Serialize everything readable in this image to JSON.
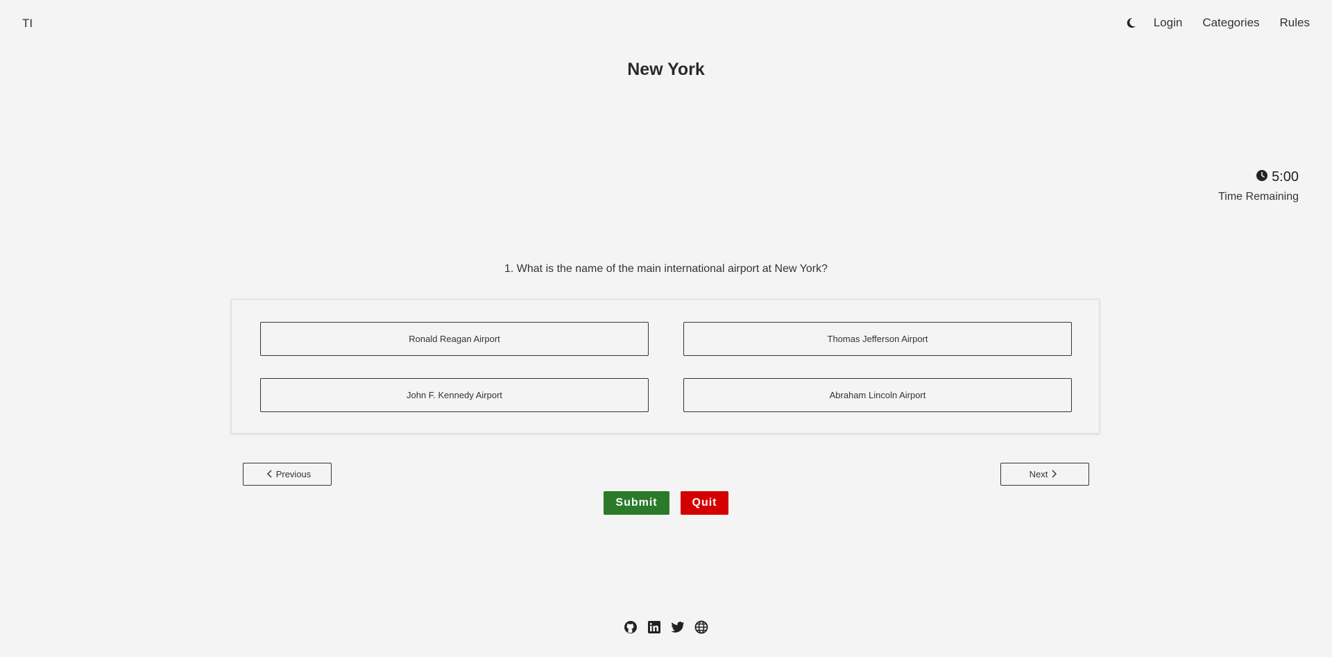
{
  "nav": {
    "logo": "TI",
    "theme_icon": "moon-icon",
    "links": [
      "Login",
      "Categories",
      "Rules"
    ]
  },
  "quiz": {
    "title": "New York",
    "timer": {
      "icon": "clock-icon",
      "value": "5:00",
      "label": "Time Remaining"
    },
    "question": "1. What is the name of the main international airport at New York?",
    "options": [
      "Ronald Reagan Airport",
      "Thomas Jefferson Airport",
      "John F. Kennedy Airport",
      "Abraham Lincoln Airport"
    ],
    "previous_label": "Previous",
    "next_label": "Next",
    "submit_label": "Submit",
    "quit_label": "Quit"
  },
  "footer": {
    "icons": [
      "github-icon",
      "linkedin-icon",
      "twitter-icon",
      "globe-icon"
    ]
  },
  "colors": {
    "background": "#f4f4f4",
    "submit": "#2a7a2a",
    "quit": "#d40000",
    "text": "#2a2a2a"
  }
}
